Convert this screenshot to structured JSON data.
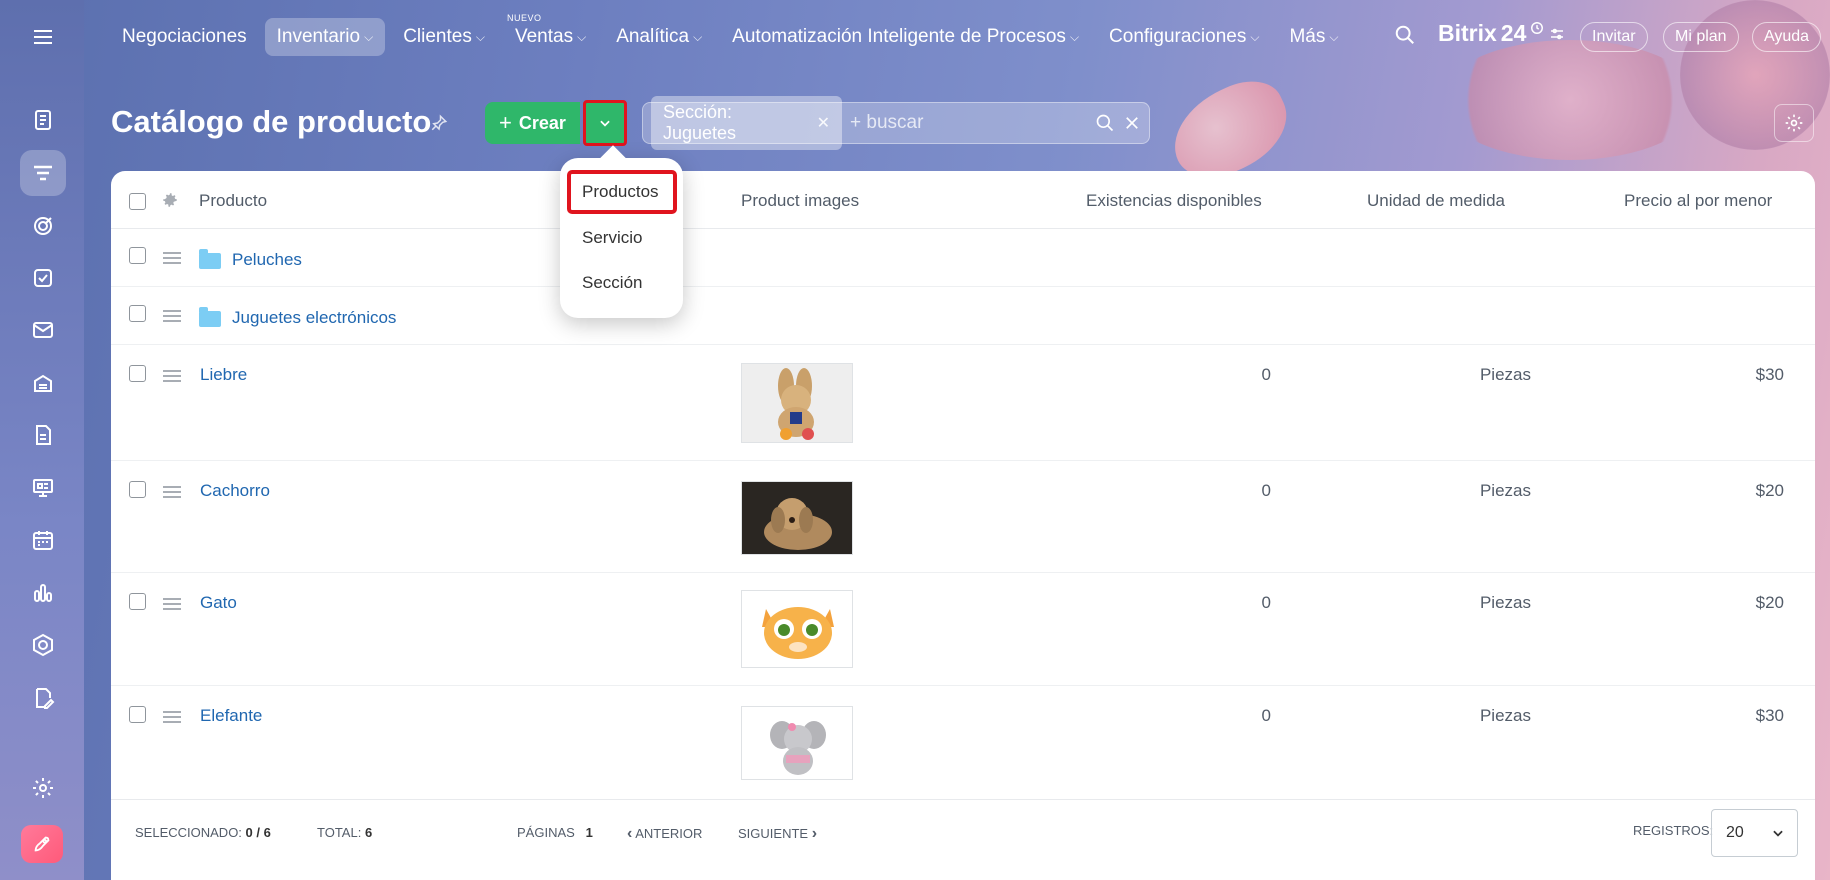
{
  "topnav": {
    "items": [
      {
        "label": "Negociaciones",
        "active": false,
        "chevron": false
      },
      {
        "label": "Inventario",
        "active": true,
        "chevron": true
      },
      {
        "label": "Clientes",
        "active": false,
        "chevron": true
      },
      {
        "label": "Ventas",
        "active": false,
        "chevron": true,
        "badge": "NUEVO"
      },
      {
        "label": "Analítica",
        "active": false,
        "chevron": true
      },
      {
        "label": "Automatización Inteligente de Procesos",
        "active": false,
        "chevron": true
      },
      {
        "label": "Configuraciones",
        "active": false,
        "chevron": true
      },
      {
        "label": "Más",
        "active": false,
        "chevron": true
      }
    ],
    "brand": "Bitrix",
    "brand_num": "24",
    "invite_label": "Invitar",
    "plan_label": "Mi plan",
    "help_label": "Ayuda"
  },
  "page": {
    "title": "Catálogo de producto",
    "create_label": "Crear",
    "filter_chip": "Sección: Juguetes",
    "search_placeholder": "+ buscar"
  },
  "dropdown": {
    "items": [
      "Productos",
      "Servicio",
      "Sección"
    ],
    "highlighted": "Productos"
  },
  "table": {
    "columns": [
      "Producto",
      "Product images",
      "Existencias disponibles",
      "Unidad de medida",
      "Precio al por menor"
    ],
    "sections": [
      {
        "name": "Peluches"
      },
      {
        "name": "Juguetes electrónicos"
      }
    ],
    "products": [
      {
        "name": "Liebre",
        "image": "plush-rabbit",
        "stock": "0",
        "unit": "Piezas",
        "price": "$30"
      },
      {
        "name": "Cachorro",
        "image": "plush-puppy",
        "stock": "0",
        "unit": "Piezas",
        "price": "$20"
      },
      {
        "name": "Gato",
        "image": "cartoon-cat",
        "stock": "0",
        "unit": "Piezas",
        "price": "$20"
      },
      {
        "name": "Elefante",
        "image": "plush-elephant",
        "stock": "0",
        "unit": "Piezas",
        "price": "$30"
      }
    ]
  },
  "footer": {
    "selected_label": "SELECCIONADO:",
    "selected_value": "0 / 6",
    "total_label": "TOTAL:",
    "total_value": "6",
    "pages_label": "PÁGINAS",
    "pages_value": "1",
    "prev_label": "ANTERIOR",
    "next_label": "SIGUIENTE",
    "records_label": "REGISTROS:",
    "records_value": "20"
  },
  "colors": {
    "accent_green": "#2fb76a",
    "highlight_red": "#e0141e",
    "link_blue": "#2067b0"
  },
  "sidebar_icons": [
    "menu-icon",
    "feed-icon",
    "funnel-icon",
    "target-icon",
    "tasks-icon",
    "mail-icon",
    "store-icon",
    "document-icon",
    "presentation-icon",
    "calendar-icon",
    "analytics-icon",
    "hexagon-icon",
    "sign-icon",
    "settings-icon",
    "rocket-icon"
  ]
}
